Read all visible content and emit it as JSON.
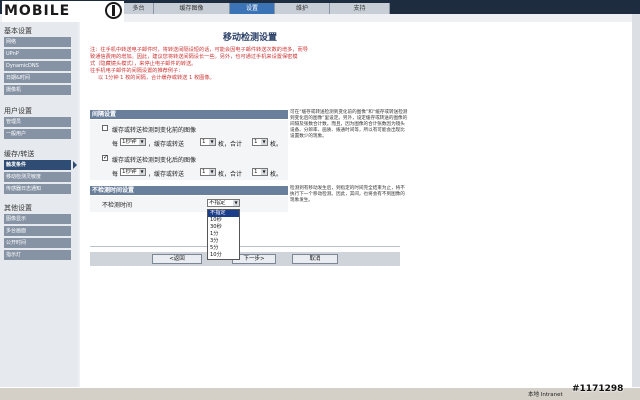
{
  "brand": {
    "logo": "MOBILE"
  },
  "tabs": [
    {
      "label": "多台"
    },
    {
      "label": "缓存图像"
    },
    {
      "label": "设置"
    },
    {
      "label": "维护"
    },
    {
      "label": "支持"
    }
  ],
  "sidebar": {
    "sections": [
      {
        "title": "基本设置",
        "items": [
          "网络",
          "UPnP",
          "DynamicDNS",
          "日期&时间",
          "摄像机"
        ]
      },
      {
        "title": "用户设置",
        "items": [
          "管理员",
          "一般用户"
        ]
      },
      {
        "title": "缓存/转送",
        "items": [
          "触发条件",
          "移动检测灵敏度",
          "传感器日志通知"
        ]
      },
      {
        "title": "其他设置",
        "items": [
          "图像显示",
          "多台画面",
          "公开时间",
          "指示灯"
        ]
      }
    ]
  },
  "main": {
    "title": "移动检测设置",
    "note": {
      "lines": [
        "注：往手机中转送电子邮件时，将转送间隔设短的话，可能会因电子邮件转送次数的增多，而导",
        "致通信费用的增加。因此，建议您将转送间隔设长一些。另外，也可通过手机来设置保密模",
        "式（隐藏镜头模式），来停止电子邮件的转送。",
        "往手机电子邮件的间隔设置的推荐例子：",
        "以 1分钟 1 枚的间隔，合计缓存或转送 1 枚图像。"
      ]
    },
    "interval_section": {
      "header": "间隔设置",
      "before": {
        "checkbox_label": "缓存或转送检测到变化前的图像",
        "prefix": "每",
        "every_value": "1秒钟",
        "mid": "，缓存或转送",
        "count_value": "1",
        "unit1": "枚，合计",
        "total_value": "1",
        "unit2": "枚。"
      },
      "after": {
        "checkbox_label": "缓存或转送检测到变化后的图像",
        "prefix": "每",
        "every_value": "1秒钟",
        "mid": "，缓存或转送",
        "count_value": "1",
        "unit1": "枚，合计",
        "total_value": "1",
        "unit2": "枚。"
      },
      "help": "可在“缓存或转送检测到变化前的图像”和“缓存或转送检测到变化后的图像”里设定。另外，设定缓存或转送的图像的间隔及张数合计数。而且，因为图像的合计张数因为镜头设备、分辨率、画质、拨通时间等，所以有可能会出现比设置数少的现象。"
    },
    "no_detect_section": {
      "header": "不检测时间设置",
      "label": "不检测时间",
      "selected": "不指定",
      "options": [
        "不指定",
        "10秒",
        "30秒",
        "1分",
        "3分",
        "5分",
        "10分"
      ],
      "highlighted_index": 0,
      "help": "检测到有移动发生后，到指定的时间完全结束为止，将不执行下一个移动检测。因此，其间，也将会有不到图像的现象发生。"
    },
    "buttons": {
      "back": "<返回",
      "next": "下一步>",
      "cancel": "取消"
    }
  },
  "taskbar": {
    "status": "本地 Intranet"
  },
  "watermark": "#1171298"
}
